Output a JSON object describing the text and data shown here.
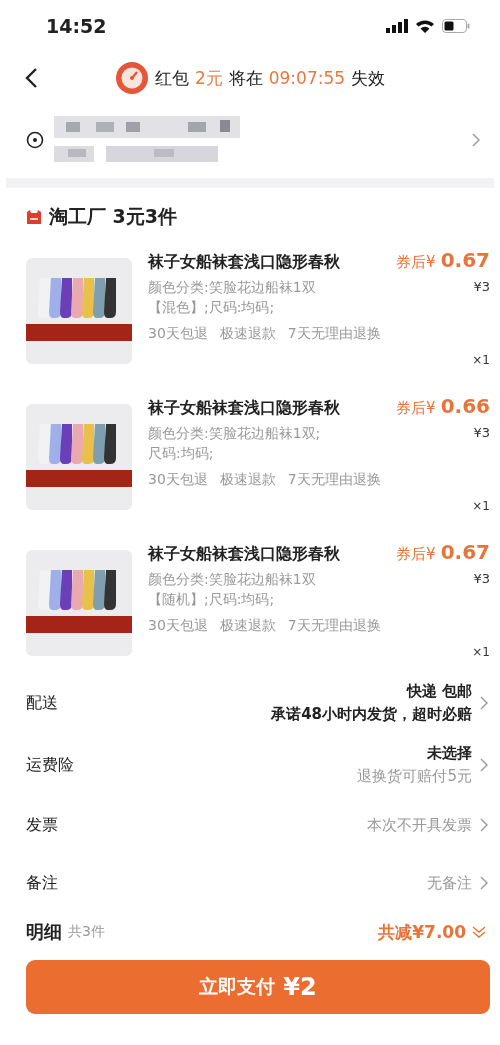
{
  "status_bar": {
    "time": "14:52"
  },
  "header": {
    "prefix": "红包",
    "amount": "2元",
    "middle": "将在",
    "countdown": "09:07:55",
    "suffix": "失效"
  },
  "shop": {
    "name": "淘工厂 3元3件"
  },
  "items": [
    {
      "title": "袜子女船袜套浅口隐形春秋",
      "price_label": "券后¥",
      "price": "0.67",
      "specs": [
        "颜色分类:笑脸花边船袜1双",
        "【混色】;尺码:均码;"
      ],
      "original_price": "¥3",
      "services": [
        "30天包退",
        "极速退款",
        "7天无理由退换"
      ],
      "quantity": "×1"
    },
    {
      "title": "袜子女船袜套浅口隐形春秋",
      "price_label": "券后¥",
      "price": "0.66",
      "specs": [
        "颜色分类:笑脸花边船袜1双;",
        "尺码:均码;"
      ],
      "original_price": "¥3",
      "services": [
        "30天包退",
        "极速退款",
        "7天无理由退换"
      ],
      "quantity": "×1"
    },
    {
      "title": "袜子女船袜套浅口隐形春秋",
      "price_label": "券后¥",
      "price": "0.67",
      "specs": [
        "颜色分类:笑脸花边船袜1双",
        "【随机】;尺码:均码;"
      ],
      "original_price": "¥3",
      "services": [
        "30天包退",
        "极速退款",
        "7天无理由退换"
      ],
      "quantity": "×1"
    }
  ],
  "rows": [
    {
      "label": "配送",
      "lines": [
        {
          "text": "快递 包邮",
          "kind": "strong"
        },
        {
          "text": "承诺48小时内发货，超时必赔",
          "kind": "strong"
        }
      ]
    },
    {
      "label": "运费险",
      "lines": [
        {
          "text": "未选择",
          "kind": "strong"
        },
        {
          "text": "退换货可赔付5元",
          "kind": "muted"
        }
      ]
    },
    {
      "label": "发票",
      "lines": [
        {
          "text": "本次不开具发票",
          "kind": "muted"
        }
      ]
    },
    {
      "label": "备注",
      "lines": [
        {
          "text": "无备注",
          "kind": "muted"
        }
      ]
    }
  ],
  "footer": {
    "label": "明细",
    "count": "共3件",
    "discount": "共减¥7.00"
  },
  "pay_button": {
    "label": "立即支付",
    "amount": "¥2"
  }
}
